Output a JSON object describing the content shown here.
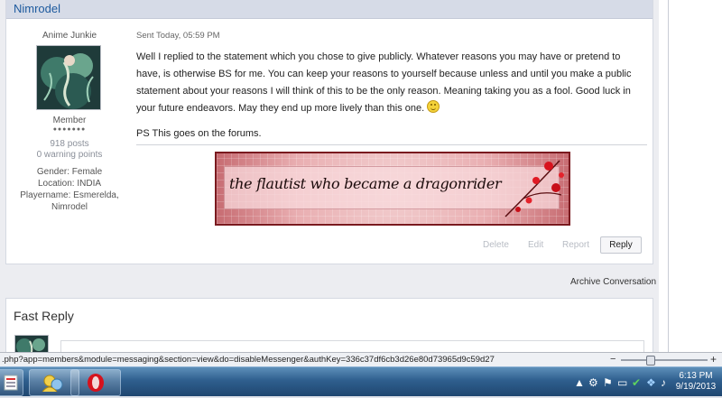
{
  "post": {
    "author": "Nimrodel",
    "author_title": "Anime Junkie",
    "group": "Member",
    "pips": "●●●●●●●",
    "post_count": "918 posts",
    "warning_points": "0 warning points",
    "custom_fields": {
      "gender_label": "Gender:",
      "gender_value": "Female",
      "location_label": "Location:",
      "location_value": "INDIA",
      "playername_label": "Playername:",
      "playername_value": "Esmerelda,",
      "playername_value2": "Nimrodel"
    },
    "sent": "Sent Today, 05:59 PM",
    "message": "Well I replied to the statement which you chose to give publicly. Whatever reasons you may have or pretend to have, is otherwise BS for me. You can keep your reasons to yourself because unless and until you make a public statement about your reasons I will think of this to be the only reason. Meaning taking you as a fool. Good luck in your future endeavors. May they end up more lively than this one.",
    "ps": "PS This goes on the forums.",
    "signature_text": "the flautist who became a dragonrider",
    "actions": {
      "delete": "Delete",
      "edit": "Edit",
      "report": "Report",
      "reply": "Reply"
    }
  },
  "archive_label": "Archive Conversation",
  "fast_reply_title": "Fast Reply",
  "status_url": ".php?app=members&module=messaging&section=view&do=disableMessenger&authKey=336c37df6cb3d26e80d73965d9c59d27",
  "taskbar": {
    "clock_time": "6:13 PM",
    "clock_date": "9/19/2013"
  },
  "colors": {
    "link": "#1d5a9e",
    "header_bg": "#d6dbe7",
    "banner_border": "#7a1a1f"
  }
}
